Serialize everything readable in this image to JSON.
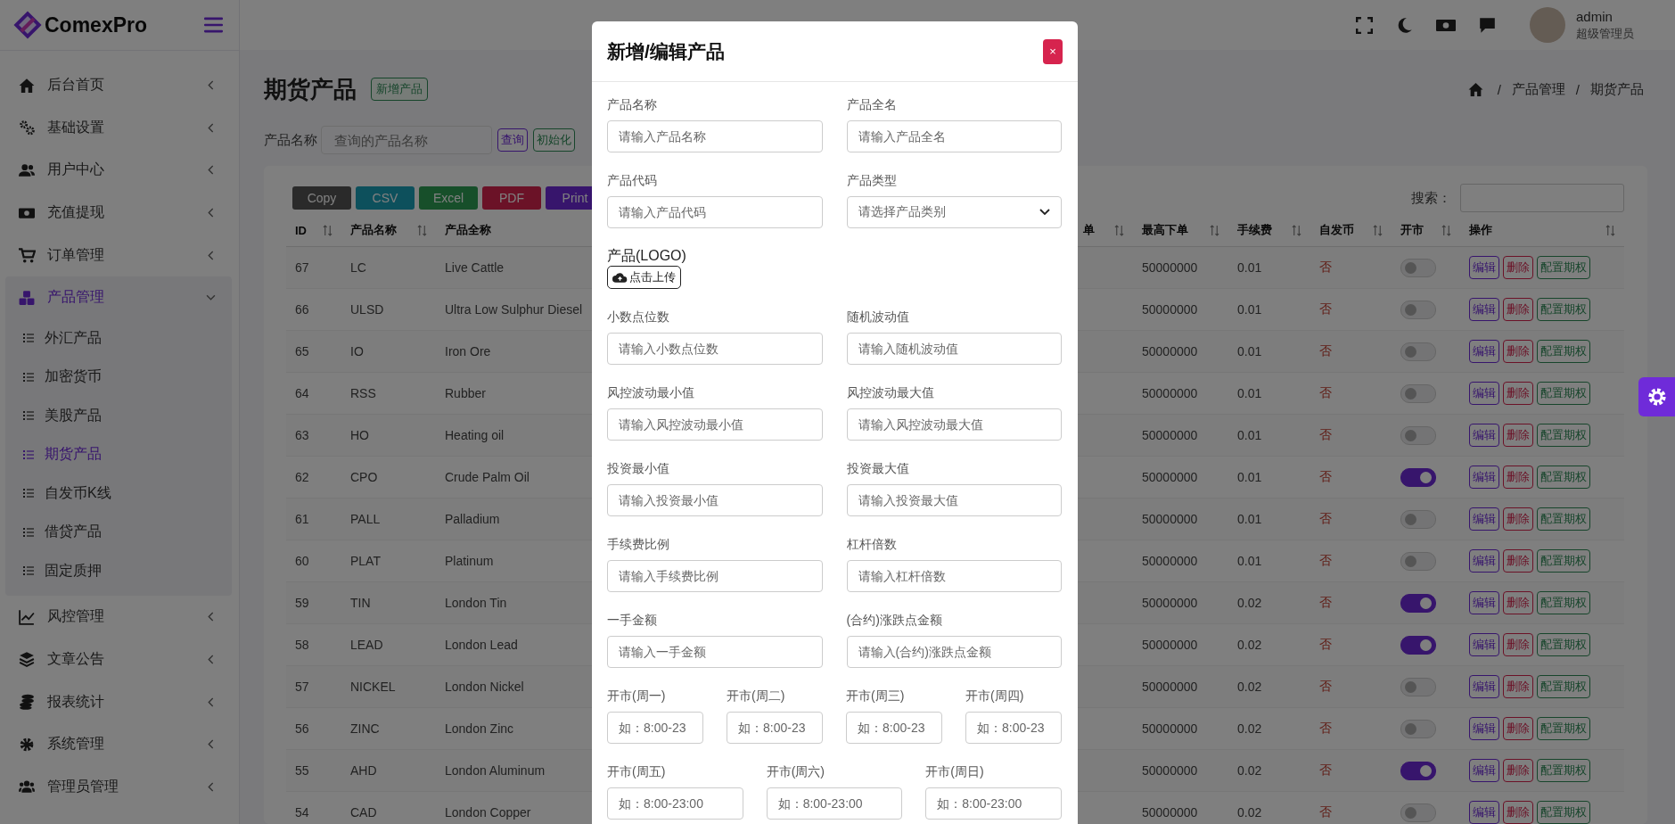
{
  "brand": {
    "name": "ComexPro"
  },
  "header": {
    "user": {
      "name": "admin",
      "role": "超级管理员"
    }
  },
  "sidebar": {
    "items": [
      {
        "label": "后台首页",
        "selected": false,
        "expanded": false
      },
      {
        "label": "基础设置",
        "selected": false,
        "expanded": false
      },
      {
        "label": "用户中心",
        "selected": false,
        "expanded": false
      },
      {
        "label": "充值提现",
        "selected": false,
        "expanded": false
      },
      {
        "label": "订单管理",
        "selected": false,
        "expanded": false
      },
      {
        "label": "产品管理",
        "selected": true,
        "expanded": true,
        "children": [
          {
            "label": "外汇产品",
            "selected": false
          },
          {
            "label": "加密货币",
            "selected": false
          },
          {
            "label": "美股产品",
            "selected": false
          },
          {
            "label": "期货产品",
            "selected": true
          },
          {
            "label": "自发币K线",
            "selected": false
          },
          {
            "label": "借贷产品",
            "selected": false
          },
          {
            "label": "固定质押",
            "selected": false
          }
        ]
      },
      {
        "label": "风控管理",
        "selected": false,
        "expanded": false
      },
      {
        "label": "文章公告",
        "selected": false,
        "expanded": false
      },
      {
        "label": "报表统计",
        "selected": false,
        "expanded": false
      },
      {
        "label": "系统管理",
        "selected": false,
        "expanded": false
      },
      {
        "label": "管理员管理",
        "selected": false,
        "expanded": false
      }
    ]
  },
  "page": {
    "title": "期货产品",
    "add_button": "新增产品",
    "breadcrumb": {
      "separator": "/",
      "items": [
        "产品管理",
        "期货产品"
      ]
    }
  },
  "filter": {
    "label": "产品名称",
    "placeholder": "查询的产品名称",
    "buttons": [
      "查询",
      "初始化"
    ]
  },
  "export_buttons": [
    "Copy",
    "CSV",
    "Excel",
    "PDF",
    "Print"
  ],
  "search": {
    "label": "搜索："
  },
  "table": {
    "columns": [
      {
        "label": "ID",
        "sortable": true
      },
      {
        "label": "产品名称",
        "sortable": true
      },
      {
        "label": "产品全称",
        "sortable": false
      },
      {
        "label": "单",
        "sortable": true
      },
      {
        "label": "最高下单",
        "sortable": true
      },
      {
        "label": "手续费",
        "sortable": true
      },
      {
        "label": "自发币",
        "sortable": true
      },
      {
        "label": "开市",
        "sortable": true
      },
      {
        "label": "操作",
        "sortable": true
      }
    ],
    "rows": [
      {
        "id": "67",
        "code": "LC",
        "name": "Live Cattle",
        "max_order": "50000000",
        "fee": "0.01",
        "self_issued": "否",
        "open": false,
        "actions": [
          "编辑",
          "删除",
          "配置期权"
        ]
      },
      {
        "id": "66",
        "code": "ULSD",
        "name": "Ultra Low Sulphur Diesel",
        "max_order": "50000000",
        "fee": "0.01",
        "self_issued": "否",
        "open": false,
        "actions": [
          "编辑",
          "删除",
          "配置期权"
        ]
      },
      {
        "id": "65",
        "code": "IO",
        "name": "Iron Ore",
        "max_order": "50000000",
        "fee": "0.01",
        "self_issued": "否",
        "open": false,
        "actions": [
          "编辑",
          "删除",
          "配置期权"
        ]
      },
      {
        "id": "64",
        "code": "RSS",
        "name": "Rubber",
        "max_order": "50000000",
        "fee": "0.01",
        "self_issued": "否",
        "open": false,
        "actions": [
          "编辑",
          "删除",
          "配置期权"
        ]
      },
      {
        "id": "63",
        "code": "HO",
        "name": "Heating oil",
        "max_order": "50000000",
        "fee": "0.01",
        "self_issued": "否",
        "open": false,
        "actions": [
          "编辑",
          "删除",
          "配置期权"
        ]
      },
      {
        "id": "62",
        "code": "CPO",
        "name": "Crude Palm Oil",
        "max_order": "50000000",
        "fee": "0.01",
        "self_issued": "否",
        "open": true,
        "actions": [
          "编辑",
          "删除",
          "配置期权"
        ]
      },
      {
        "id": "61",
        "code": "PALL",
        "name": "Palladium",
        "max_order": "50000000",
        "fee": "0.01",
        "self_issued": "否",
        "open": false,
        "actions": [
          "编辑",
          "删除",
          "配置期权"
        ]
      },
      {
        "id": "60",
        "code": "PLAT",
        "name": "Platinum",
        "max_order": "50000000",
        "fee": "0.01",
        "self_issued": "否",
        "open": false,
        "actions": [
          "编辑",
          "删除",
          "配置期权"
        ]
      },
      {
        "id": "59",
        "code": "TIN",
        "name": "London Tin",
        "max_order": "50000000",
        "fee": "0.02",
        "self_issued": "否",
        "open": true,
        "actions": [
          "编辑",
          "删除",
          "配置期权"
        ]
      },
      {
        "id": "58",
        "code": "LEAD",
        "name": "London Lead",
        "max_order": "50000000",
        "fee": "0.02",
        "self_issued": "否",
        "open": true,
        "actions": [
          "编辑",
          "删除",
          "配置期权"
        ]
      },
      {
        "id": "57",
        "code": "NICKEL",
        "name": "London Nickel",
        "max_order": "50000000",
        "fee": "0.02",
        "self_issued": "否",
        "open": false,
        "actions": [
          "编辑",
          "删除",
          "配置期权"
        ]
      },
      {
        "id": "56",
        "code": "ZINC",
        "name": "London Zinc",
        "max_order": "50000000",
        "fee": "0.02",
        "self_issued": "否",
        "open": false,
        "actions": [
          "编辑",
          "删除",
          "配置期权"
        ]
      },
      {
        "id": "55",
        "code": "AHD",
        "name": "London Aluminum",
        "max_order": "50000000",
        "fee": "0.02",
        "self_issued": "否",
        "open": true,
        "actions": [
          "编辑",
          "删除",
          "配置期权"
        ]
      },
      {
        "id": "54",
        "code": "CAD",
        "name": "London Copper",
        "max_order": "50000000",
        "fee": "0.02",
        "self_issued": "否",
        "open": false,
        "actions": [
          "编辑",
          "删除",
          "配置期权"
        ]
      }
    ]
  },
  "modal": {
    "title": "新增/编辑产品",
    "close": "×",
    "fields": [
      {
        "kind": "text",
        "label": "产品名称",
        "placeholder": "请输入产品名称"
      },
      {
        "kind": "text",
        "label": "产品全名",
        "placeholder": "请输入产品全名"
      },
      {
        "kind": "text",
        "label": "产品代码",
        "placeholder": "请输入产品代码"
      },
      {
        "kind": "select",
        "label": "产品类型",
        "placeholder": "请选择产品类别"
      },
      {
        "kind": "upload",
        "label": "产品(LOGO)",
        "placeholder": "点击上传"
      },
      {
        "kind": "text",
        "label": "小数点位数",
        "placeholder": "请输入小数点位数"
      },
      {
        "kind": "text",
        "label": "随机波动值",
        "placeholder": "请输入随机波动值"
      },
      {
        "kind": "text",
        "label": "风控波动最小值",
        "placeholder": "请输入风控波动最小值"
      },
      {
        "kind": "text",
        "label": "风控波动最大值",
        "placeholder": "请输入风控波动最大值"
      },
      {
        "kind": "text",
        "label": "投资最小值",
        "placeholder": "请输入投资最小值"
      },
      {
        "kind": "text",
        "label": "投资最大值",
        "placeholder": "请输入投资最大值"
      },
      {
        "kind": "text",
        "label": "手续费比例",
        "placeholder": "请输入手续费比例"
      },
      {
        "kind": "text",
        "label": "杠杆倍数",
        "placeholder": "请输入杠杆倍数"
      },
      {
        "kind": "text",
        "label": "一手金额",
        "placeholder": "请输入一手金额"
      },
      {
        "kind": "text",
        "label": "(合约)涨跌点金额",
        "placeholder": "请输入(合约)涨跌点金额"
      }
    ],
    "time_rows": [
      [
        {
          "label": "开市(周一)",
          "placeholder": "如：8:00-23"
        },
        {
          "label": "开市(周二)",
          "placeholder": "如：8:00-23"
        },
        {
          "label": "开市(周三)",
          "placeholder": "如：8:00-23"
        },
        {
          "label": "开市(周四)",
          "placeholder": "如：8:00-23"
        }
      ],
      [
        {
          "label": "开市(周五)",
          "placeholder": "如：8:00-23:00"
        },
        {
          "label": "开市(周六)",
          "placeholder": "如：8:00-23:00"
        },
        {
          "label": "开市(周日)",
          "placeholder": "如：8:00-23:00"
        }
      ]
    ]
  }
}
